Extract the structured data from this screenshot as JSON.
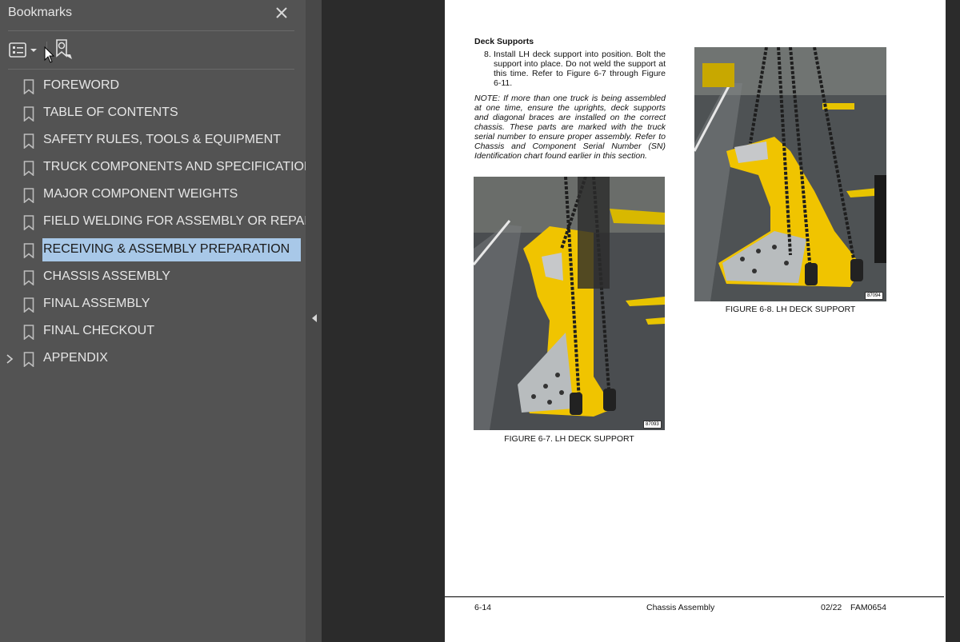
{
  "sidebar": {
    "title": "Bookmarks",
    "items": [
      {
        "label": "FOREWORD"
      },
      {
        "label": "TABLE OF CONTENTS"
      },
      {
        "label": "SAFETY RULES, TOOLS & EQUIPMENT"
      },
      {
        "label": "TRUCK COMPONENTS AND SPECIFICATIONS"
      },
      {
        "label": "MAJOR COMPONENT WEIGHTS"
      },
      {
        "label": "FIELD WELDING FOR ASSEMBLY OR REPAIR"
      },
      {
        "label": "RECEIVING & ASSEMBLY PREPARATION",
        "selected": true
      },
      {
        "label": "CHASSIS ASSEMBLY"
      },
      {
        "label": "FINAL ASSEMBLY"
      },
      {
        "label": "FINAL CHECKOUT"
      },
      {
        "label": "APPENDIX",
        "expandable": true
      }
    ]
  },
  "document": {
    "section_title": "Deck Supports",
    "step_number": "8.",
    "step_text": "Install LH deck support into position. Bolt the support into place. Do not weld the support at this time. Refer to Figure 6-7 through Figure 6-11.",
    "note": "NOTE: If more than one truck is being assembled at one time, ensure the uprights, deck supports and diagonal braces are installed on the correct chassis. These parts are marked with the truck serial number to ensure proper assembly. Refer to Chassis and Component Serial Number (SN) Identification chart found earlier in this section.",
    "figures": [
      {
        "caption": "FIGURE 6-7. LH DECK SUPPORT",
        "id": "87093"
      },
      {
        "caption": "FIGURE 6-8. LH DECK SUPPORT",
        "id": "87094"
      }
    ],
    "footer": {
      "page": "6-14",
      "section": "Chassis Assembly",
      "date": "02/22",
      "code": "FAM0654"
    }
  },
  "colors": {
    "sidebar_bg": "#535353",
    "selection": "#a8c8e8",
    "doc_bg": "#2b2b2b",
    "yellow_part": "#f0c400"
  },
  "icons": {
    "close": "close-icon",
    "options": "list-options-icon",
    "new_bookmark": "new-bookmark-icon",
    "bookmark": "bookmark-icon",
    "expand": "chevron-right-icon",
    "collapse": "chevron-left-icon"
  }
}
